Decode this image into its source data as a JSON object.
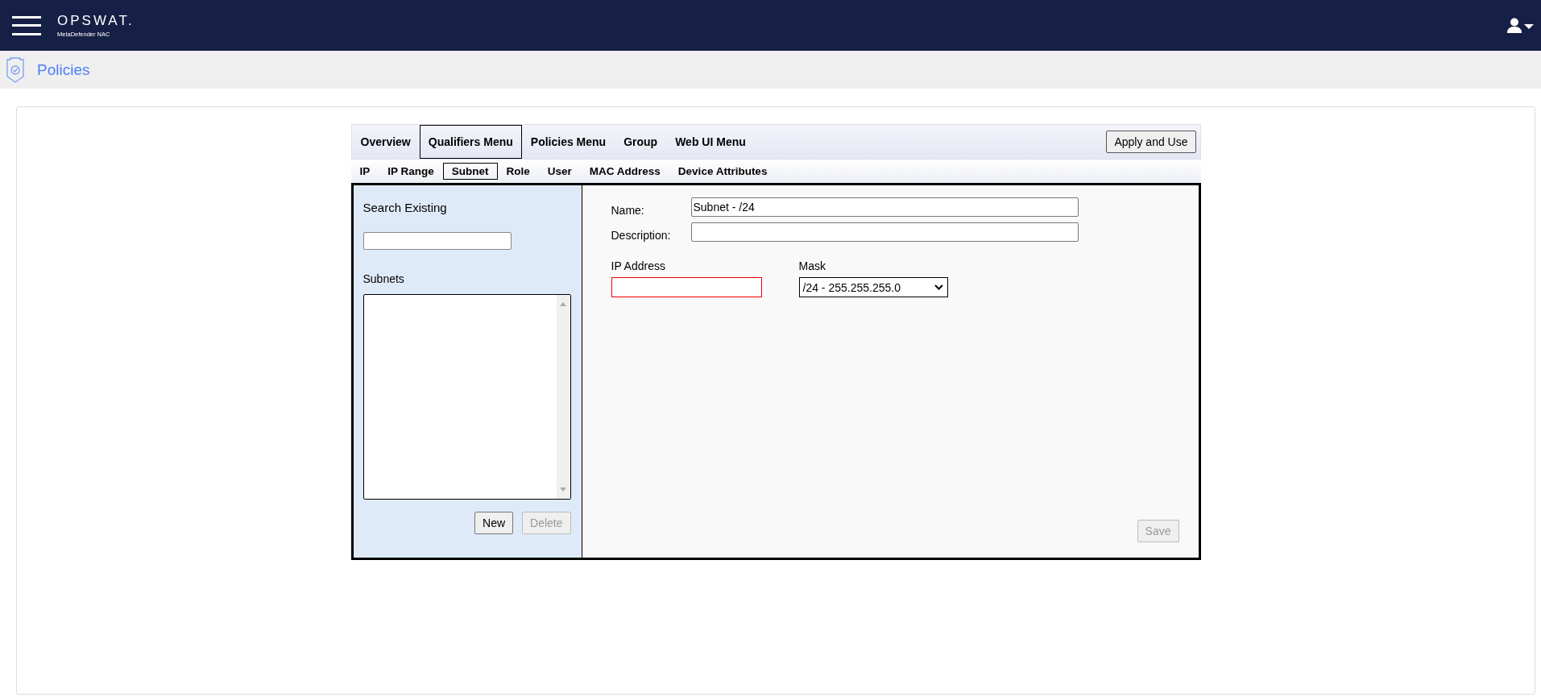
{
  "header": {
    "logo": "OPSWAT.",
    "product": "MetaDefender NAC"
  },
  "breadcrumb": {
    "title": "Policies"
  },
  "tabs": [
    {
      "label": "Overview",
      "selected": false
    },
    {
      "label": "Qualifiers Menu",
      "selected": true
    },
    {
      "label": "Policies Menu",
      "selected": false
    },
    {
      "label": "Group",
      "selected": false
    },
    {
      "label": "Web UI Menu",
      "selected": false
    }
  ],
  "apply_button": "Apply and Use",
  "subtabs": [
    {
      "label": "IP",
      "selected": false
    },
    {
      "label": "IP Range",
      "selected": false
    },
    {
      "label": "Subnet",
      "selected": true
    },
    {
      "label": "Role",
      "selected": false
    },
    {
      "label": "User",
      "selected": false
    },
    {
      "label": "MAC Address",
      "selected": false
    },
    {
      "label": "Device Attributes",
      "selected": false
    }
  ],
  "sidebar": {
    "search_label": "Search Existing",
    "list_label": "Subnets",
    "buttons": [
      {
        "label": "New",
        "disabled": false
      },
      {
        "label": "Delete",
        "disabled": true
      }
    ]
  },
  "form": {
    "name_label": "Name:",
    "name_value": "Subnet - /24",
    "description_label": "Description:",
    "ip_label": "IP Address",
    "ip_invalid": true,
    "mask_label": "Mask",
    "mask_value": "/24 - 255.255.255.0",
    "save": {
      "label": "Save",
      "disabled": true
    }
  }
}
